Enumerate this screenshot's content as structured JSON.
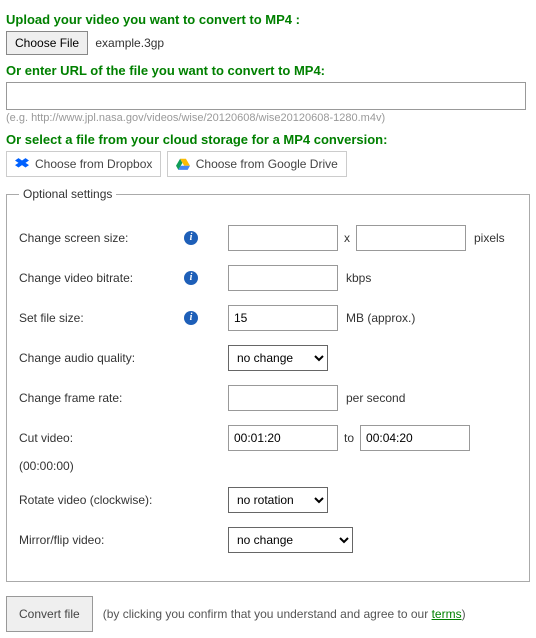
{
  "upload": {
    "heading": "Upload your video you want to convert to MP4 :",
    "choose_btn": "Choose File",
    "file_name": "example.3gp"
  },
  "url": {
    "heading": "Or enter URL of the file you want to convert to MP4:",
    "value": "",
    "example": "(e.g. http://www.jpl.nasa.gov/videos/wise/20120608/wise20120608-1280.m4v)"
  },
  "cloud": {
    "heading": "Or select a file from your cloud storage for a MP4 conversion:",
    "dropbox": "Choose from Dropbox",
    "gdrive": "Choose from Google Drive"
  },
  "optional": {
    "legend": "Optional settings",
    "screen_size": {
      "label": "Change screen size:",
      "w": "",
      "h": "",
      "suffix": "pixels",
      "x": "x"
    },
    "bitrate": {
      "label": "Change video bitrate:",
      "value": "",
      "suffix": "kbps"
    },
    "filesize": {
      "label": "Set file size:",
      "value": "15",
      "suffix": "MB (approx.)"
    },
    "audio": {
      "label": "Change audio quality:",
      "selected": "no change"
    },
    "framerate": {
      "label": "Change frame rate:",
      "value": "",
      "suffix": "per second"
    },
    "cut": {
      "label": "Cut video:",
      "from": "00:01:20",
      "to_label": "to",
      "to": "00:04:20",
      "note": "(00:00:00)"
    },
    "rotate": {
      "label": "Rotate video (clockwise):",
      "selected": "no rotation"
    },
    "mirror": {
      "label": "Mirror/flip video:",
      "selected": "no change"
    }
  },
  "submit": {
    "btn": "Convert file",
    "disclaimer_a": "(by clicking you confirm that you understand and agree to our ",
    "terms": "terms",
    "disclaimer_b": ")"
  }
}
